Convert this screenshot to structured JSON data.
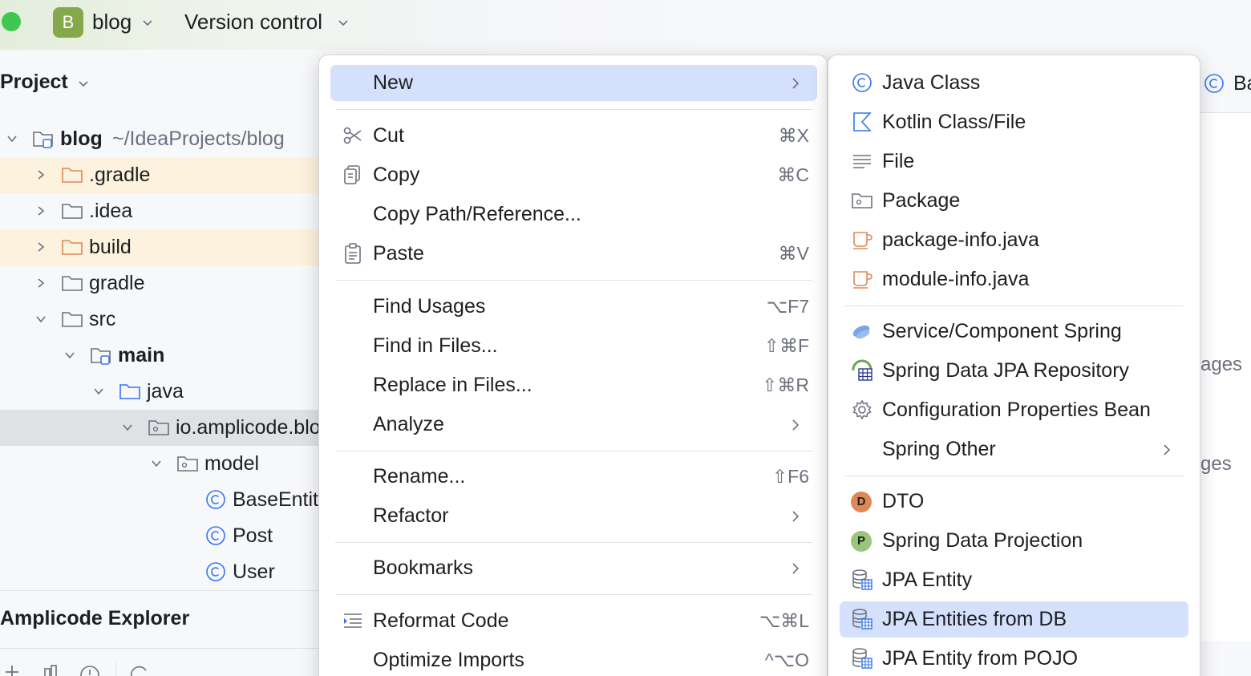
{
  "topbar": {
    "project_badge": "B",
    "project_name": "blog",
    "vcs_label": "Version control"
  },
  "project_pane": {
    "title": "Project",
    "tree": [
      {
        "label": "blog",
        "path": "~/IdeaProjects/blog",
        "icon": "module-folder-icon"
      },
      {
        "label": ".gradle",
        "icon": "folder-icon"
      },
      {
        "label": ".idea",
        "icon": "folder-icon"
      },
      {
        "label": "build",
        "icon": "folder-icon"
      },
      {
        "label": "gradle",
        "icon": "folder-icon"
      },
      {
        "label": "src",
        "icon": "folder-icon"
      },
      {
        "label": "main",
        "icon": "source-root-folder-icon"
      },
      {
        "label": "java",
        "icon": "source-folder-icon"
      },
      {
        "label": "io.amplicode.blo",
        "icon": "package-icon"
      },
      {
        "label": "model",
        "icon": "package-icon"
      },
      {
        "label": "BaseEntit",
        "icon": "class-icon"
      },
      {
        "label": "Post",
        "icon": "class-icon"
      },
      {
        "label": "User",
        "icon": "class-icon"
      }
    ],
    "explorer_title": "Amplicode Explorer"
  },
  "background": {
    "tab_label": "Ba",
    "text1": "ages",
    "text2": "ges"
  },
  "context_menu": {
    "items": [
      {
        "label": "New",
        "shortcut": "",
        "submenu": true
      },
      {
        "label": "Cut",
        "shortcut": "⌘X",
        "icon": "scissors-icon"
      },
      {
        "label": "Copy",
        "shortcut": "⌘C",
        "icon": "copy-icon"
      },
      {
        "label": "Copy Path/Reference...",
        "shortcut": ""
      },
      {
        "label": "Paste",
        "shortcut": "⌘V",
        "icon": "clipboard-icon"
      },
      {
        "label": "Find Usages",
        "shortcut": "⌥F7"
      },
      {
        "label": "Find in Files...",
        "shortcut": "⇧⌘F"
      },
      {
        "label": "Replace in Files...",
        "shortcut": "⇧⌘R"
      },
      {
        "label": "Analyze",
        "shortcut": "",
        "submenu": true
      },
      {
        "label": "Rename...",
        "shortcut": "⇧F6"
      },
      {
        "label": "Refactor",
        "shortcut": "",
        "submenu": true
      },
      {
        "label": "Bookmarks",
        "shortcut": "",
        "submenu": true
      },
      {
        "label": "Reformat Code",
        "shortcut": "⌥⌘L",
        "icon": "reformat-icon"
      },
      {
        "label": "Optimize Imports",
        "shortcut": "^⌥O"
      }
    ]
  },
  "new_submenu": {
    "items": [
      {
        "label": "Java Class",
        "icon": "java-class-icon"
      },
      {
        "label": "Kotlin Class/File",
        "icon": "kotlin-icon"
      },
      {
        "label": "File",
        "icon": "file-icon"
      },
      {
        "label": "Package",
        "icon": "package-icon"
      },
      {
        "label": "package-info.java",
        "icon": "java-file-icon"
      },
      {
        "label": "module-info.java",
        "icon": "java-file-icon"
      },
      {
        "label": "Service/Component Spring",
        "icon": "spring-bean-icon"
      },
      {
        "label": "Spring Data JPA Repository",
        "icon": "spring-repository-icon"
      },
      {
        "label": "Configuration Properties Bean",
        "icon": "gear-icon"
      },
      {
        "label": "Spring Other",
        "submenu": true
      },
      {
        "label": "DTO",
        "icon": "dto-icon",
        "badge": "D"
      },
      {
        "label": "Spring Data Projection",
        "icon": "projection-icon",
        "badge": "P"
      },
      {
        "label": "JPA Entity",
        "icon": "jpa-entity-icon"
      },
      {
        "label": "JPA Entities from DB",
        "icon": "jpa-entity-icon"
      },
      {
        "label": "JPA Entity from POJO",
        "icon": "jpa-entity-icon"
      }
    ]
  },
  "colors": {
    "selection": "#d4e0fc",
    "accent_blue": "#3574f0",
    "folder_orange": "#e08855",
    "project_badge": "#86a84d"
  }
}
